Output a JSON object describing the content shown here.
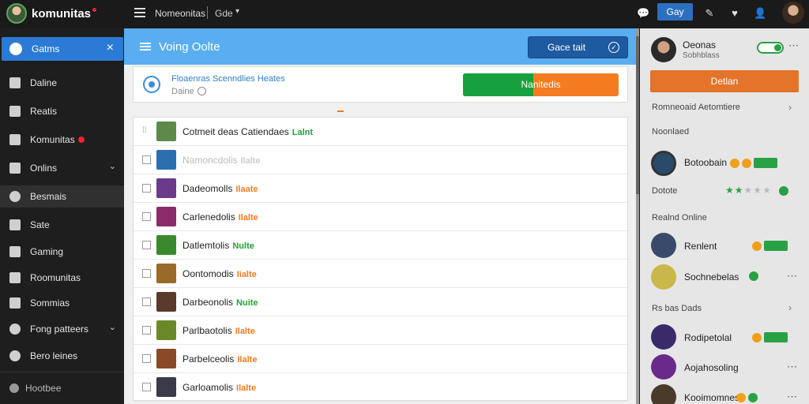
{
  "topbar": {
    "brand": "komunitas",
    "title": "Nomeonitas",
    "subtitle": "Gde",
    "action_button": "Gay"
  },
  "sidebar": {
    "active": {
      "label": "Gatms"
    },
    "items": [
      {
        "label": "Daline"
      },
      {
        "label": "Reatis"
      },
      {
        "label": "Komunitas"
      },
      {
        "label": "Onlins"
      },
      {
        "label": "Besmais"
      },
      {
        "label": "Sate"
      },
      {
        "label": "Gaming"
      },
      {
        "label": "Roomunitas"
      },
      {
        "label": "Sommias"
      },
      {
        "label": "Fong patteers"
      },
      {
        "label": "Bero leines"
      }
    ],
    "footer": "Hootbee"
  },
  "main": {
    "header_title": "Voing Oolte",
    "header_button": "Gace tait",
    "status": {
      "title": "Floaenras Scenndlies Heates",
      "subtitle": "Daine",
      "progress_label": "Nanitedis",
      "progress_fraction": 0.45
    },
    "rows": [
      {
        "name": "Cotmeit deas Catiendaes",
        "status": "Lalnt",
        "status_color": "green",
        "thumb": "#5d8a4a"
      },
      {
        "name": "Namoncdolis",
        "status": "Ilalte",
        "status_color": "faded",
        "thumb": "#2b6fb0"
      },
      {
        "name": "Dadeomolls",
        "status": "Ilaate",
        "status_color": "orange",
        "thumb": "#6b3a8a"
      },
      {
        "name": "Carlenedolis",
        "status": "Ilalte",
        "status_color": "orange",
        "thumb": "#8a2d6a"
      },
      {
        "name": "Datlemtolis",
        "status": "Nulte",
        "status_color": "green",
        "thumb": "#3a8a2d"
      },
      {
        "name": "Oontomodis",
        "status": "Iialte",
        "status_color": "orange",
        "thumb": "#9a6a2a"
      },
      {
        "name": "Darbeonolis",
        "status": "Nuite",
        "status_color": "green",
        "thumb": "#5a3a2a"
      },
      {
        "name": "Parlbaotolis",
        "status": "Ilalte",
        "status_color": "orange",
        "thumb": "#6a8a2a"
      },
      {
        "name": "Parbelceolis",
        "status": "Ilalte",
        "status_color": "orange",
        "thumb": "#8a4a2a"
      },
      {
        "name": "Garloamolis",
        "status": "Ilalte",
        "status_color": "orange",
        "thumb": "#3a3a4a"
      }
    ]
  },
  "rpanel": {
    "user_name": "Oeonas",
    "user_sub": "Sobhblass",
    "cta": "Detlan",
    "sections": [
      "Romneoaid Aetomtiere",
      "Noonlaed",
      "Realnd Online",
      "Rs bas Dads"
    ],
    "people": [
      {
        "name": "Botoobain",
        "color": "#2a4a6a"
      },
      {
        "name": "Dotote",
        "stars": 2
      },
      {
        "name": "Renlent",
        "color": "#3a4a6a"
      },
      {
        "name": "Sochnebelas",
        "color": "#8a8a2a"
      },
      {
        "name": "Rodipetolal",
        "color": "#3a2a6a"
      },
      {
        "name": "Aojahosoling",
        "color": "#6a2a8a"
      },
      {
        "name": "Kooimomnes",
        "color": "#4a3a2a"
      }
    ]
  }
}
